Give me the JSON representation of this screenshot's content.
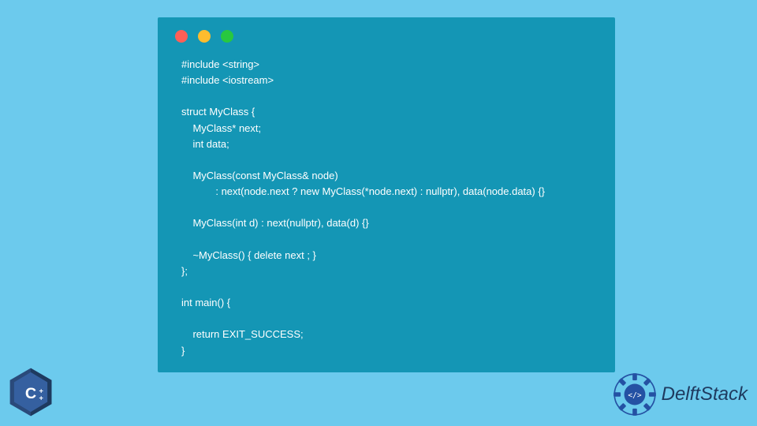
{
  "code": {
    "lines": [
      "#include <string>",
      "#include <iostream>",
      "",
      "struct MyClass {",
      "    MyClass* next;",
      "    int data;",
      "",
      "    MyClass(const MyClass& node)",
      "            : next(node.next ? new MyClass(*node.next) : nullptr), data(node.data) {}",
      "",
      "    MyClass(int d) : next(nullptr), data(d) {}",
      "",
      "    ~MyClass() { delete next ; }",
      "};",
      "",
      "int main() {",
      "",
      "    return EXIT_SUCCESS;",
      "}"
    ]
  },
  "branding": {
    "cpp_label": "C++",
    "delftstack_label": "DelftStack"
  },
  "colors": {
    "background": "#6ccaed",
    "window": "#1496b5",
    "code_text": "#ffffff"
  }
}
